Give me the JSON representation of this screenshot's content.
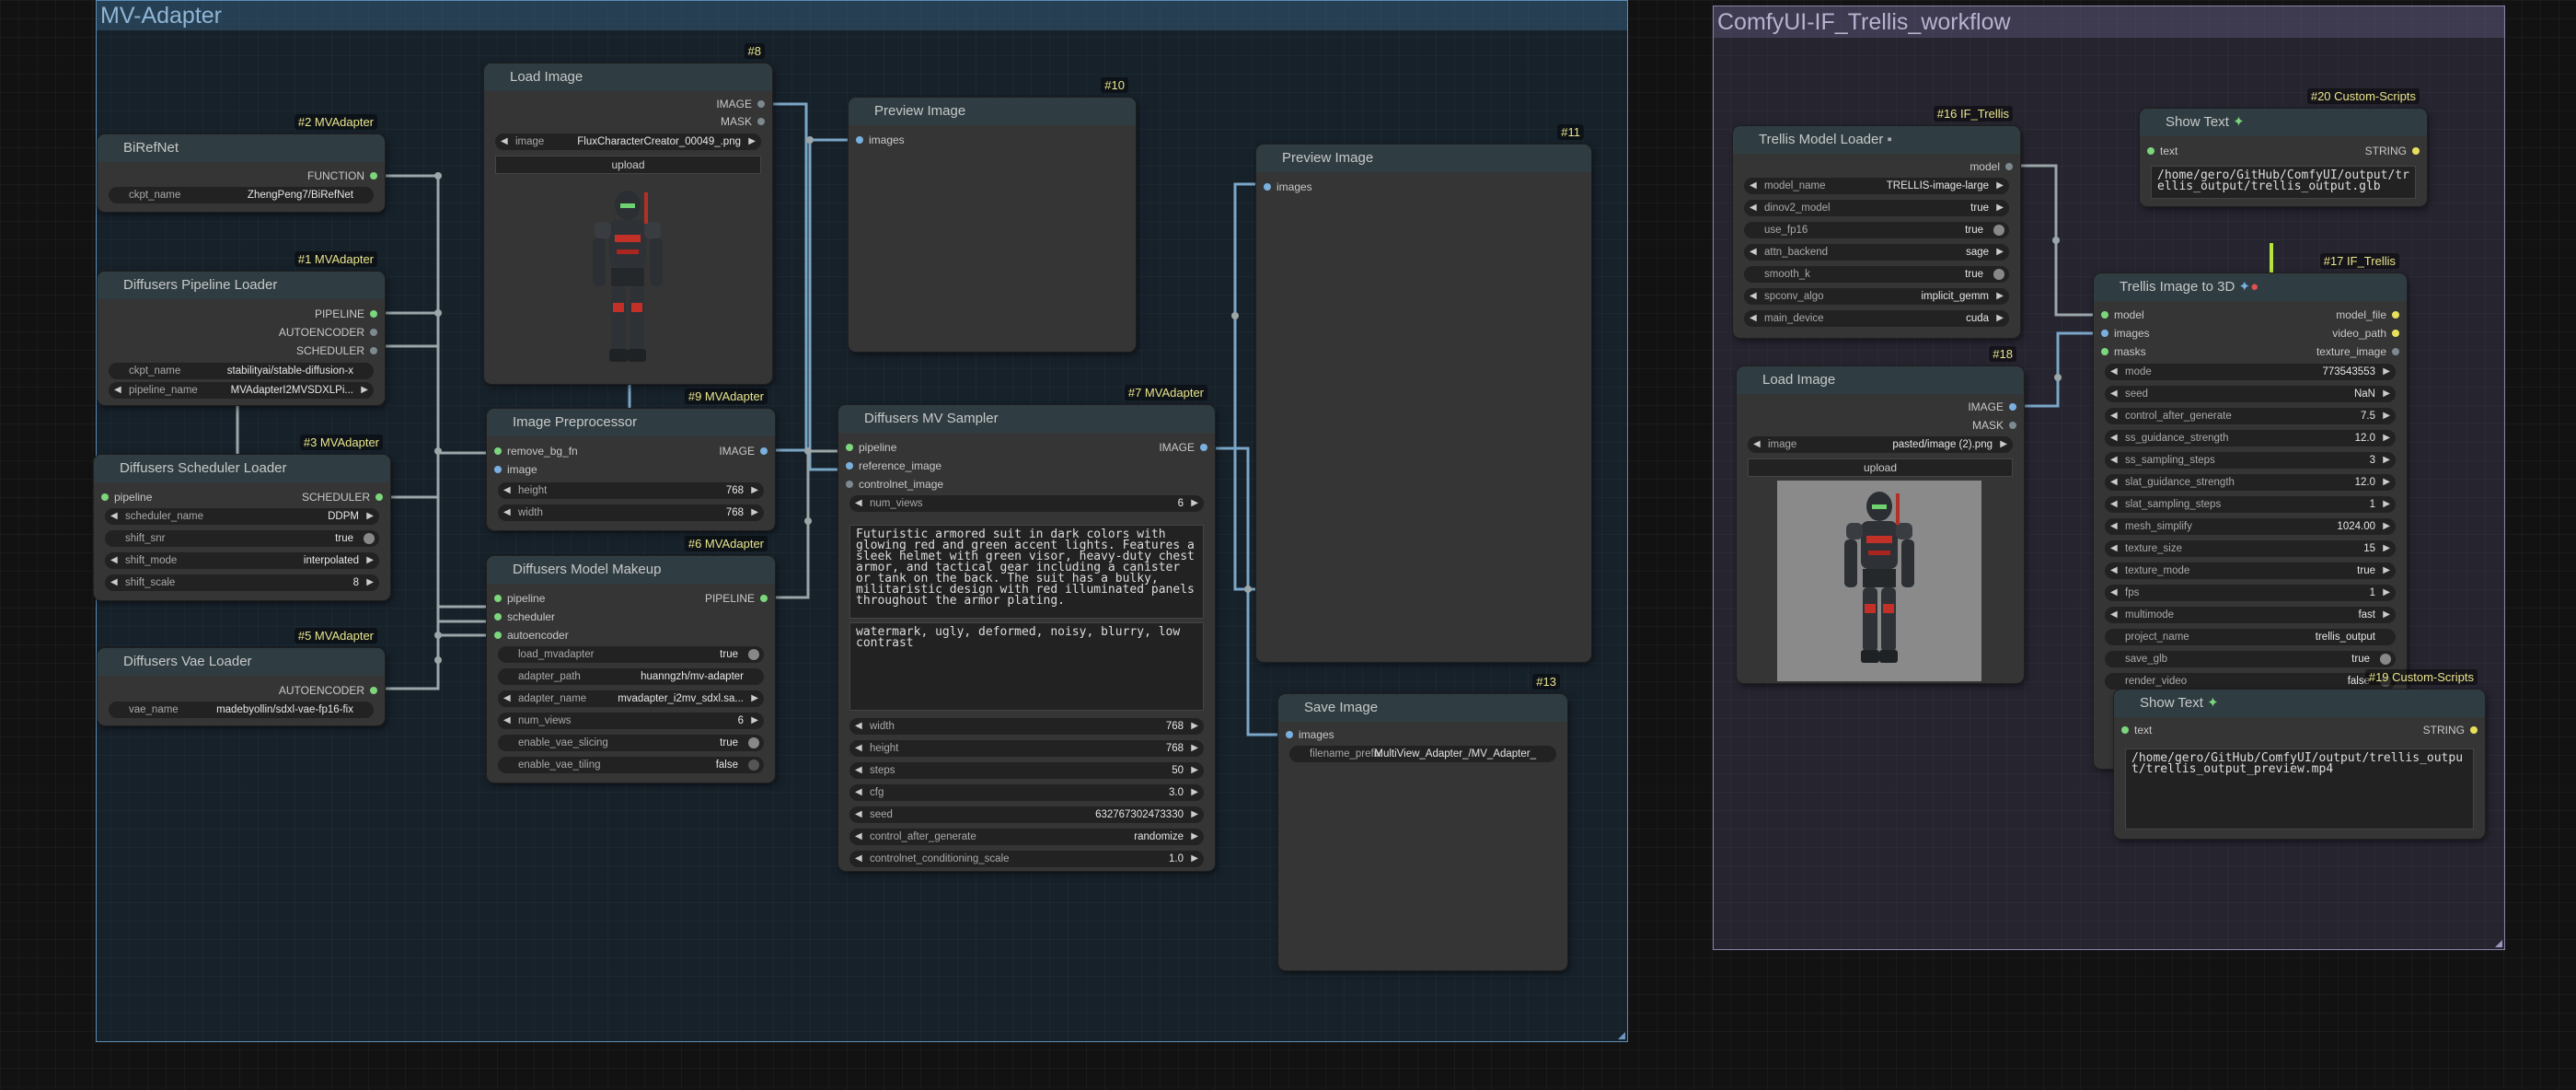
{
  "groups": {
    "mvadapter": {
      "title": "MV-Adapter"
    },
    "trellis": {
      "title": "ComfyUI-IF_Trellis_workflow"
    }
  },
  "icons": {
    "floppy": "floppy-icon",
    "sparkle": "sparkle-icon",
    "check": "check-icon"
  },
  "colors": {
    "node_bg": "#353535",
    "link_green": "#7cd67c",
    "badge": "#eae58c"
  },
  "nodes": {
    "birefnet": {
      "badge": "#2 MVAdapter",
      "title": "BiRefNet",
      "out": "FUNCTION",
      "ckpt_name_k": "ckpt_name",
      "ckpt_name_v": "ZhengPeng7/BiRefNet"
    },
    "pipeline_loader": {
      "badge": "#1 MVAdapter",
      "title": "Diffusers Pipeline Loader",
      "outs": [
        "PIPELINE",
        "AUTOENCODER",
        "SCHEDULER"
      ],
      "ckpt_k": "ckpt_name",
      "ckpt_v": "stabilityai/stable-diffusion-x",
      "pipe_k": "pipeline_name",
      "pipe_v": "MVAdapterI2MVSDXLPi..."
    },
    "scheduler_loader": {
      "badge": "#3 MVAdapter",
      "title": "Diffusers Scheduler Loader",
      "in": "pipeline",
      "out": "SCHEDULER",
      "w": [
        [
          "scheduler_name",
          "DDPM"
        ],
        [
          "shift_snr",
          "true"
        ],
        [
          "shift_mode",
          "interpolated"
        ],
        [
          "shift_scale",
          "8"
        ]
      ]
    },
    "vae_loader": {
      "badge": "#5 MVAdapter",
      "title": "Diffusers Vae Loader",
      "out": "AUTOENCODER",
      "vae_k": "vae_name",
      "vae_v": "madebyollin/sdxl-vae-fp16-fix"
    },
    "load_image": {
      "badge": "#8",
      "title": "Load Image",
      "outs": [
        "IMAGE",
        "MASK"
      ],
      "img_k": "image",
      "img_v": "FluxCharacterCreator_00049_.png",
      "upload": "upload"
    },
    "preprocessor": {
      "badge": "#9 MVAdapter",
      "title": "Image Preprocessor",
      "ins": [
        "remove_bg_fn",
        "image"
      ],
      "out": "IMAGE",
      "w": [
        [
          "height",
          "768"
        ],
        [
          "width",
          "768"
        ]
      ]
    },
    "model_makeup": {
      "badge": "#6 MVAdapter",
      "title": "Diffusers Model Makeup",
      "ins": [
        "pipeline",
        "scheduler",
        "autoencoder"
      ],
      "out": "PIPELINE",
      "w": [
        [
          "load_mvadapter",
          "true"
        ],
        [
          "adapter_path",
          "huanngzh/mv-adapter"
        ],
        [
          "adapter_name",
          "mvadapter_i2mv_sdxl.sa..."
        ],
        [
          "num_views",
          "6"
        ],
        [
          "enable_vae_slicing",
          "true"
        ],
        [
          "enable_vae_tiling",
          "false"
        ]
      ]
    },
    "preview1": {
      "badge": "#10",
      "title": "Preview Image",
      "in": "images"
    },
    "mv_sampler": {
      "badge": "#7 MVAdapter",
      "title": "Diffusers MV Sampler",
      "ins": [
        "pipeline",
        "reference_image",
        "controlnet_image"
      ],
      "out": "IMAGE",
      "num_views_k": "num_views",
      "num_views_v": "6",
      "prompt": "Futuristic armored suit in dark colors with glowing red and green accent lights. Features a sleek helmet with green visor, heavy-duty chest armor, and tactical gear including a canister or tank on the back. The suit has a bulky, militaristic design with red illuminated panels throughout the armor plating.",
      "negative": "watermark, ugly, deformed, noisy, blurry, low contrast",
      "w": [
        [
          "width",
          "768"
        ],
        [
          "height",
          "768"
        ],
        [
          "steps",
          "50"
        ],
        [
          "cfg",
          "3.0"
        ],
        [
          "seed",
          "632767302473330"
        ],
        [
          "control_after_generate",
          "randomize"
        ],
        [
          "controlnet_conditioning_scale",
          "1.0"
        ]
      ]
    },
    "preview2": {
      "badge": "#11",
      "title": "Preview Image",
      "in": "images"
    },
    "save_image": {
      "badge": "#13",
      "title": "Save Image",
      "in": "images",
      "prefix_k": "filename_prefix",
      "prefix_v": "MultiView_Adapter_/MV_Adapter_"
    },
    "trellis_loader": {
      "badge": "#16 IF_Trellis",
      "title": "Trellis Model Loader",
      "out": "model",
      "w": [
        [
          "model_name",
          "TRELLIS-image-large"
        ],
        [
          "dinov2_model",
          "true"
        ],
        [
          "use_fp16",
          "true"
        ],
        [
          "attn_backend",
          "sage"
        ],
        [
          "smooth_k",
          "true"
        ],
        [
          "spconv_algo",
          "implicit_gemm"
        ],
        [
          "main_device",
          "cuda"
        ]
      ]
    },
    "show_text1": {
      "badge": "#20 Custom-Scripts",
      "title": "Show Text",
      "in": "text",
      "out": "STRING",
      "text": "/home/gero/GitHub/ComfyUI/output/trellis_output/trellis_output.glb"
    },
    "load_image2": {
      "badge": "#18",
      "title": "Load Image",
      "outs": [
        "IMAGE",
        "MASK"
      ],
      "img_k": "image",
      "img_v": "pasted/image (2).png",
      "upload": "upload"
    },
    "trellis_3d": {
      "badge": "#17 IF_Trellis",
      "title": "Trellis Image to 3D",
      "ins": [
        "model",
        "images",
        "masks"
      ],
      "outs": [
        "model_file",
        "video_path",
        "texture_image"
      ],
      "w": [
        [
          "mode",
          "773543553"
        ],
        [
          "seed",
          "NaN"
        ],
        [
          "control_after_generate",
          "7.5"
        ],
        [
          "ss_guidance_strength",
          "12.0"
        ],
        [
          "ss_sampling_steps",
          "3"
        ],
        [
          "slat_guidance_strength",
          "12.0"
        ],
        [
          "slat_sampling_steps",
          "1"
        ],
        [
          "mesh_simplify",
          "1024.00"
        ],
        [
          "texture_size",
          "15"
        ],
        [
          "texture_mode",
          "true"
        ],
        [
          "fps",
          "1"
        ],
        [
          "multimode",
          "fast"
        ],
        [
          "project_name",
          "trellis_output"
        ],
        [
          "save_glb",
          "true"
        ],
        [
          "render_video",
          "false"
        ]
      ]
    },
    "show_text2": {
      "badge": "#19 Custom-Scripts",
      "title": "Show Text",
      "in": "text",
      "out": "STRING",
      "text": "/home/gero/GitHub/ComfyUI/output/trellis_output/trellis_output_preview.mp4"
    }
  }
}
